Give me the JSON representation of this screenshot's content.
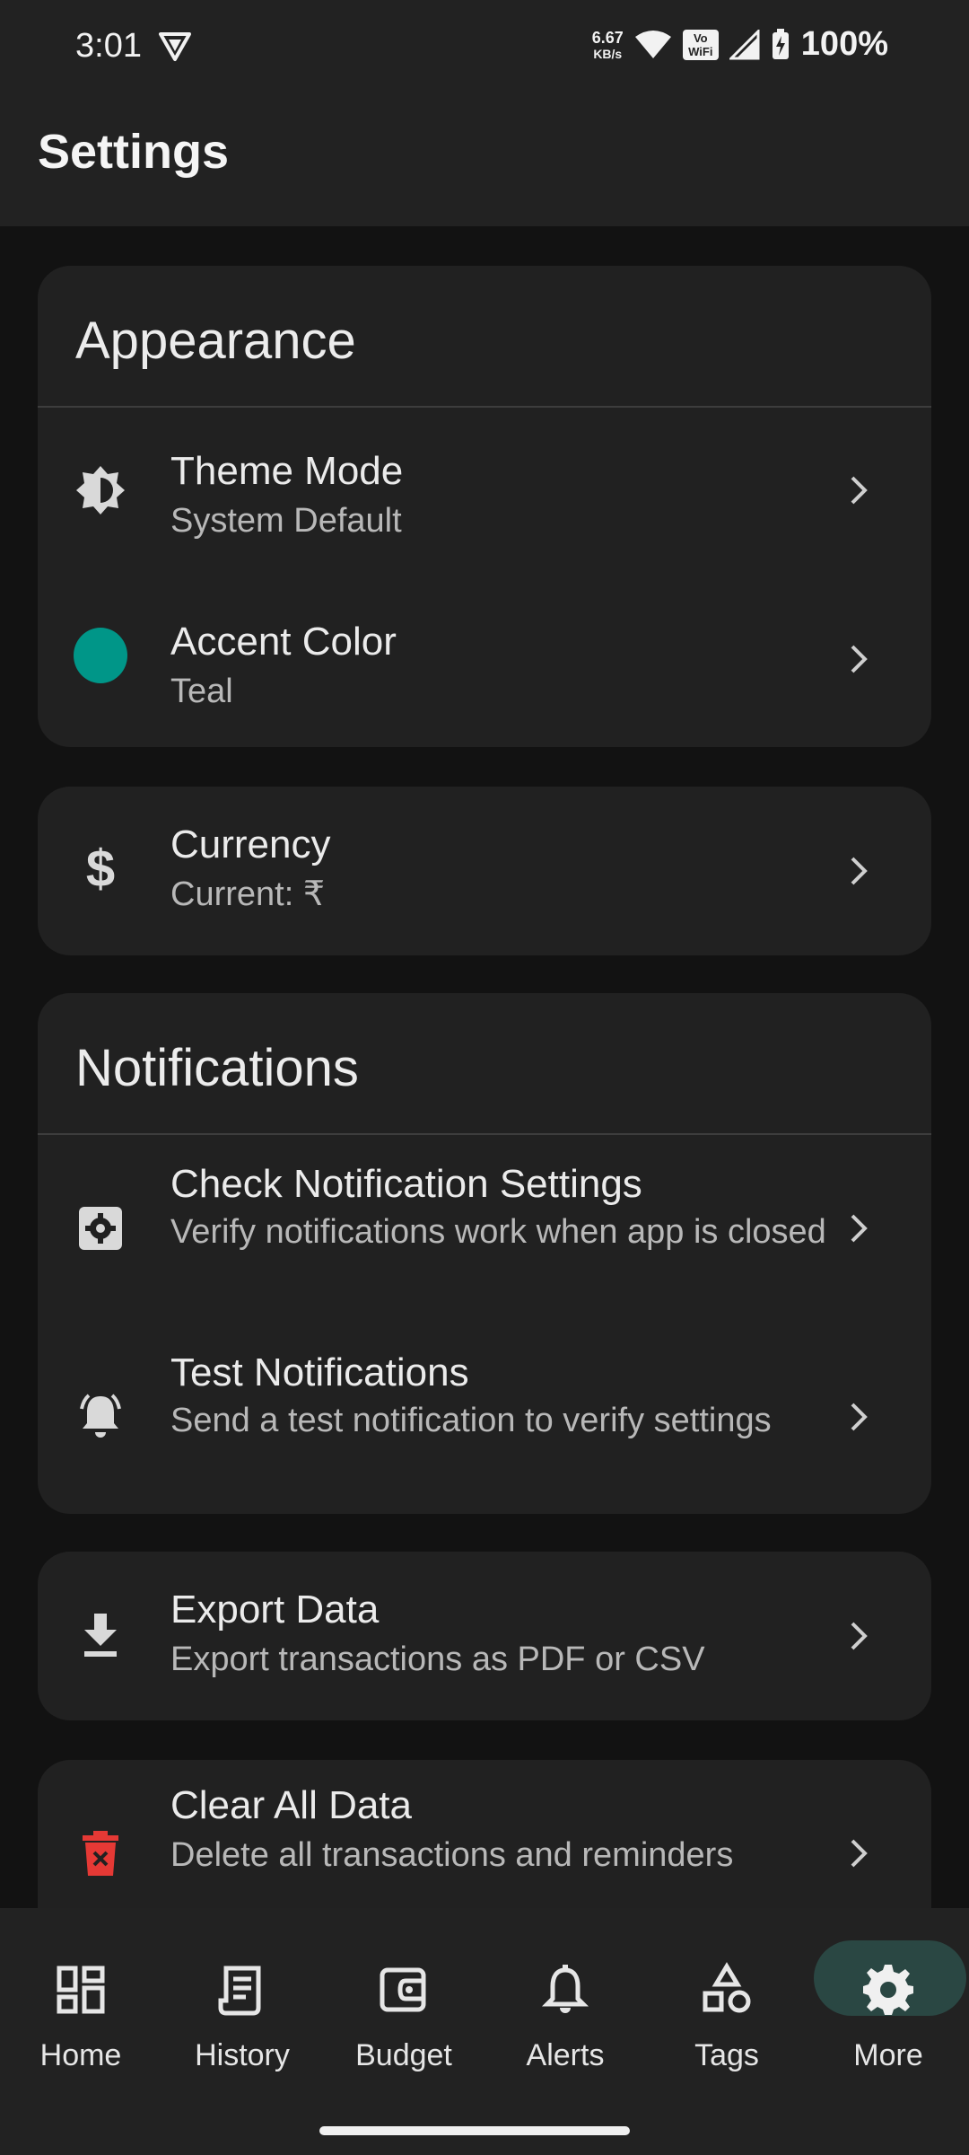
{
  "status_bar": {
    "time": "3:01",
    "speed_value": "6.67",
    "speed_unit": "KB/s",
    "vowifi_label": "Vo WiFi",
    "battery": "100%"
  },
  "app_bar": {
    "title": "Settings"
  },
  "appearance": {
    "header": "Appearance",
    "theme": {
      "title": "Theme Mode",
      "subtitle": "System Default",
      "icon": "brightness-icon"
    },
    "accent": {
      "title": "Accent Color",
      "subtitle": "Teal",
      "color": "#009688"
    }
  },
  "currency": {
    "title": "Currency",
    "subtitle": "Current: ₹",
    "icon": "dollar-icon"
  },
  "notifications": {
    "header": "Notifications",
    "check": {
      "title": "Check Notification Settings",
      "subtitle": "Verify notifications work when app is closed",
      "icon": "settings-box-icon"
    },
    "test": {
      "title": "Test Notifications",
      "subtitle": "Send a test notification to verify settings",
      "icon": "bell-ring-icon"
    }
  },
  "export": {
    "title": "Export Data",
    "subtitle": "Export transactions as PDF or CSV",
    "icon": "download-icon"
  },
  "clear": {
    "title": "Clear All Data",
    "subtitle": "Delete all transactions and reminders",
    "icon": "trash-icon",
    "icon_color": "#e53935"
  },
  "bottom_nav": {
    "items": [
      {
        "label": "Home",
        "icon": "dashboard-icon"
      },
      {
        "label": "History",
        "icon": "receipt-icon"
      },
      {
        "label": "Budget",
        "icon": "wallet-icon"
      },
      {
        "label": "Alerts",
        "icon": "bell-icon"
      },
      {
        "label": "Tags",
        "icon": "shapes-icon"
      },
      {
        "label": "More",
        "icon": "gear-icon"
      }
    ],
    "active": "More",
    "active_pill_color": "#2a4743"
  }
}
